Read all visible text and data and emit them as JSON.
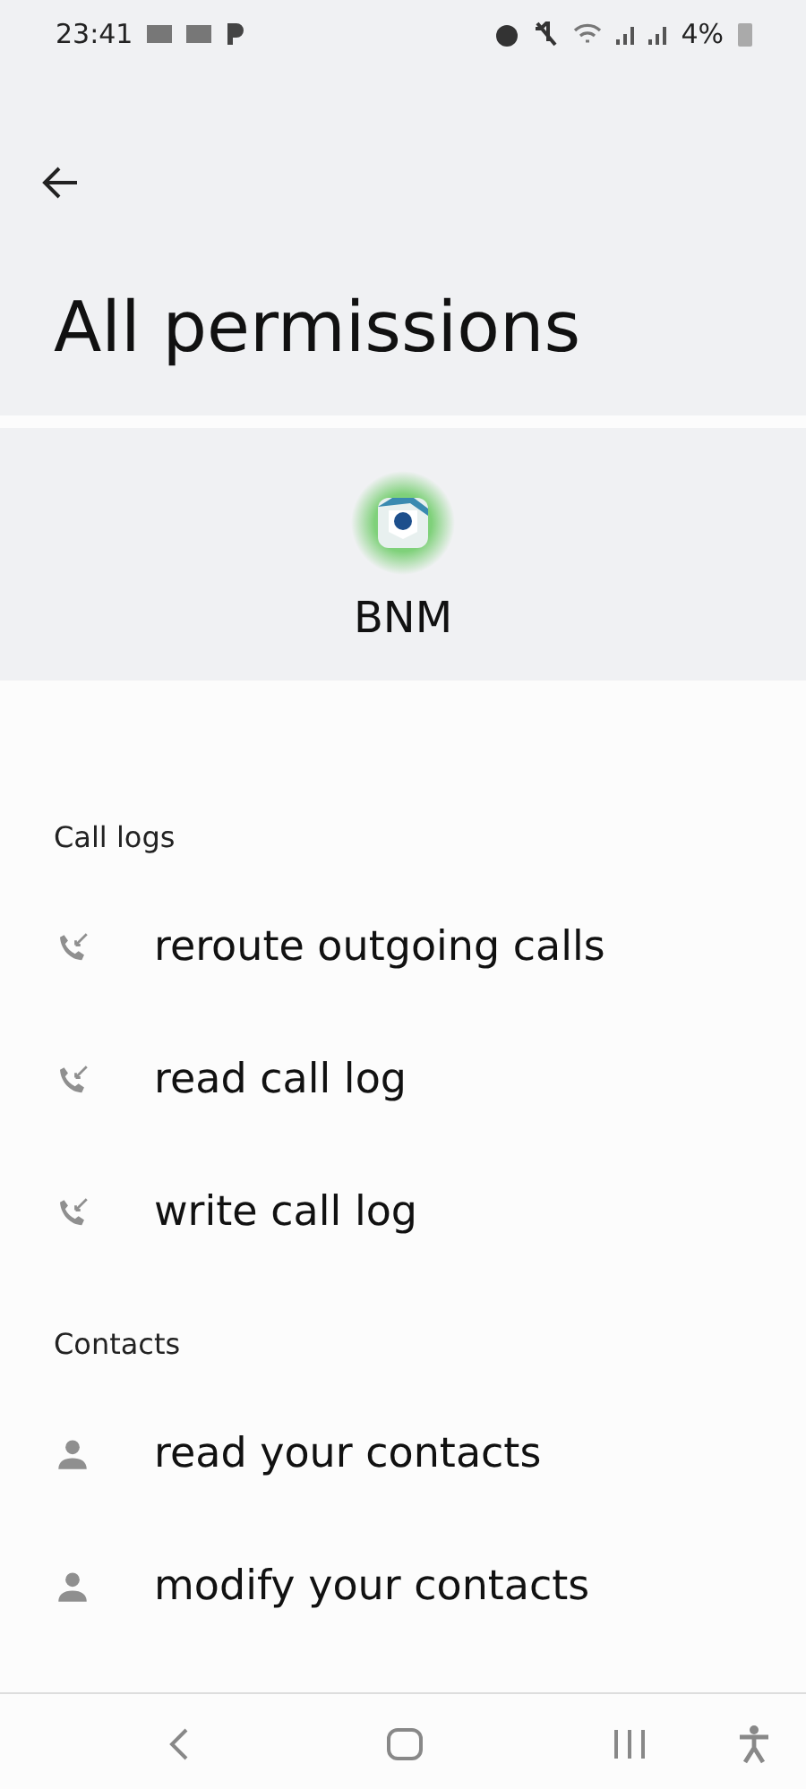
{
  "status_bar": {
    "time": "23:41",
    "battery": "4%"
  },
  "header": {
    "title": "All permissions"
  },
  "app": {
    "name": "BNM"
  },
  "groups": [
    {
      "title": "Call logs",
      "items": [
        {
          "label": "reroute outgoing calls",
          "kind": "call"
        },
        {
          "label": "read call log",
          "kind": "call"
        },
        {
          "label": "write call log",
          "kind": "call"
        }
      ]
    },
    {
      "title": "Contacts",
      "items": [
        {
          "label": "read your contacts",
          "kind": "contact"
        },
        {
          "label": "modify your contacts",
          "kind": "contact"
        }
      ]
    }
  ]
}
